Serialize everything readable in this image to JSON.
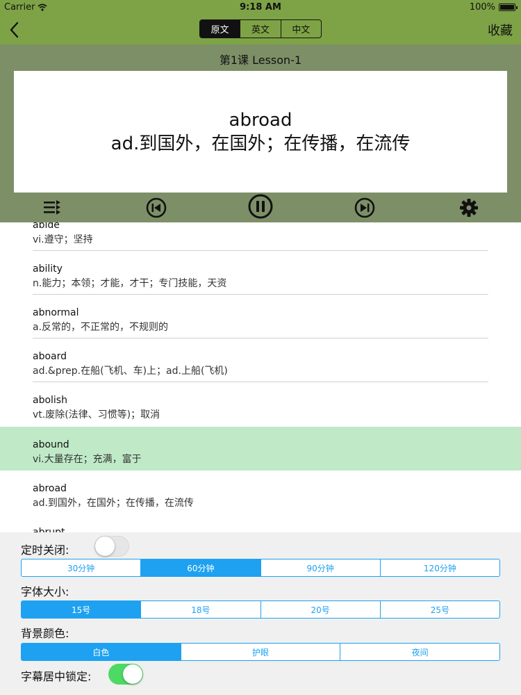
{
  "status": {
    "carrier": "Carrier",
    "time": "9:18 AM",
    "battery": "100%"
  },
  "nav": {
    "tabs": [
      {
        "label": "原文",
        "active": true
      },
      {
        "label": "英文",
        "active": false
      },
      {
        "label": "中文",
        "active": false
      }
    ],
    "favorite": "收藏"
  },
  "player": {
    "lesson": "第1课  Lesson-1",
    "word": "abroad",
    "meaning": "ad.到国外，在国外；在传播，在流传",
    "icons": [
      "playlist-icon",
      "previous-icon",
      "pause-icon",
      "next-icon",
      "gear-icon"
    ]
  },
  "words": [
    {
      "en": "abide",
      "cn": "vi.遵守；坚持"
    },
    {
      "en": "ability",
      "cn": "n.能力；本领；才能，才干；专门技能，天资"
    },
    {
      "en": "abnormal",
      "cn": "a.反常的，不正常的，不规则的"
    },
    {
      "en": "aboard",
      "cn": "ad.&prep.在船(飞机、车)上；ad.上船(飞机)"
    },
    {
      "en": "abolish",
      "cn": "vt.废除(法律、习惯等)；取消"
    },
    {
      "en": "abound",
      "cn": "vi.大量存在；充满，富于"
    },
    {
      "en": "abroad",
      "cn": "ad.到国外，在国外；在传播，在流传"
    },
    {
      "en": "abrupt",
      "cn": ""
    }
  ],
  "settings": {
    "timer_label": "定时关闭:",
    "timer_enabled": false,
    "timer_options": [
      "30分钟",
      "60分钟",
      "90分钟",
      "120分钟"
    ],
    "timer_selected": "60分钟",
    "font_label": "字体大小:",
    "font_options": [
      "15号",
      "18号",
      "20号",
      "25号"
    ],
    "font_selected": "15号",
    "bg_label": "背景颜色:",
    "bg_options": [
      "白色",
      "护眼",
      "夜间"
    ],
    "bg_selected": "白色",
    "lock_label": "字幕居中锁定:",
    "lock_enabled": true
  },
  "colors": {
    "bar": "#7ea346",
    "player_bg": "#7d8f67",
    "highlight": "#bfe9c7",
    "accent": "#1ea1f1",
    "toggle_on": "#4cd964"
  }
}
